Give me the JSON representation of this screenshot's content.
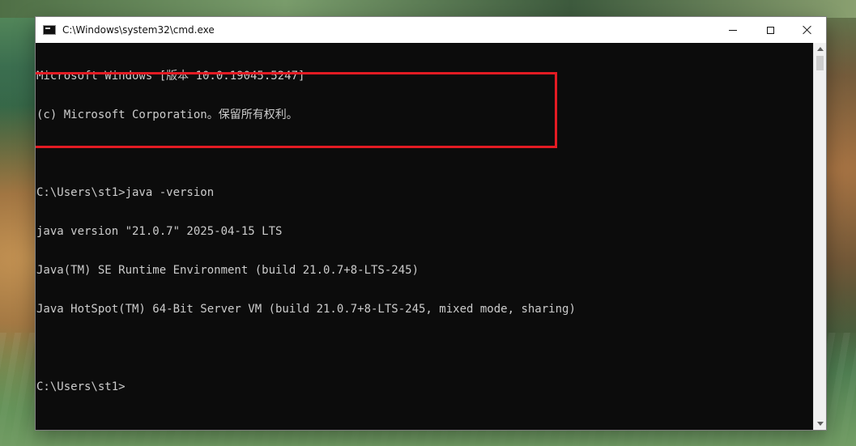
{
  "window": {
    "title": "C:\\Windows\\system32\\cmd.exe",
    "controls": {
      "minimize": "minimize",
      "maximize": "maximize",
      "close": "close"
    }
  },
  "console": {
    "lines": [
      "Microsoft Windows [版本 10.0.19045.5247]",
      "(c) Microsoft Corporation。保留所有权利。",
      "",
      "C:\\Users\\st1>java -version",
      "java version \"21.0.7\" 2025-04-15 LTS",
      "Java(TM) SE Runtime Environment (build 21.0.7+8-LTS-245)",
      "Java HotSpot(TM) 64-Bit Server VM (build 21.0.7+8-LTS-245, mixed mode, sharing)",
      "",
      "C:\\Users\\st1>"
    ]
  },
  "colors": {
    "console_background": "#0c0c0c",
    "console_text": "#cccccc",
    "highlight_border": "#e31b23",
    "titlebar_background": "#ffffff"
  },
  "icons": {
    "window_icon": "cmd-icon",
    "minimize_icon": "minimize-icon",
    "maximize_icon": "maximize-icon",
    "close_icon": "close-icon"
  }
}
